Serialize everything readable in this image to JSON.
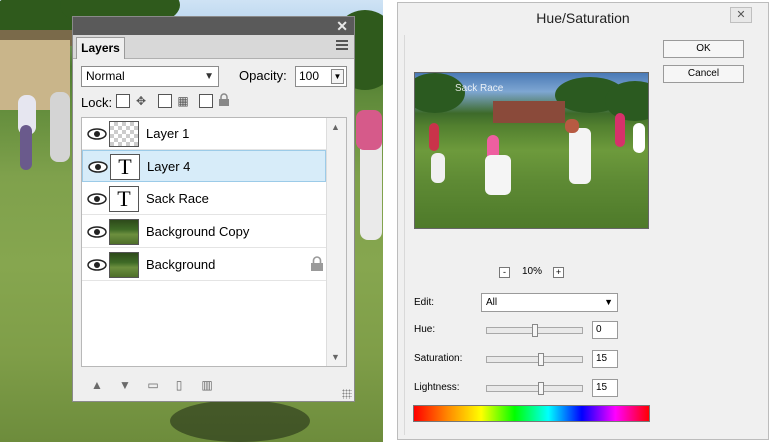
{
  "layers_panel": {
    "tab_label": "Layers",
    "blend_mode": "Normal",
    "opacity_label": "Opacity:",
    "opacity_value": "100",
    "lock_label": "Lock:",
    "layers": [
      {
        "name": "Layer 1",
        "thumb": "transparent",
        "selected": false,
        "locked": false
      },
      {
        "name": "Layer 4",
        "thumb": "text",
        "selected": true,
        "locked": false
      },
      {
        "name": "Sack Race",
        "thumb": "text",
        "selected": false,
        "locked": false
      },
      {
        "name": "Background Copy",
        "thumb": "image",
        "selected": false,
        "locked": false
      },
      {
        "name": "Background",
        "thumb": "image",
        "selected": false,
        "locked": true
      }
    ],
    "thumb_text_glyph": "T"
  },
  "hue_saturation": {
    "title": "Hue/Saturation",
    "ok_label": "OK",
    "cancel_label": "Cancel",
    "preview_caption": "Sack Race",
    "zoom": "10%",
    "edit_label": "Edit:",
    "edit_value": "All",
    "hue_label": "Hue:",
    "hue_value": "0",
    "saturation_label": "Saturation:",
    "saturation_value": "15",
    "lightness_label": "Lightness:",
    "lightness_value": "15",
    "slider_fractions": {
      "hue": 0.5,
      "saturation": 0.575,
      "lightness": 0.575
    }
  }
}
